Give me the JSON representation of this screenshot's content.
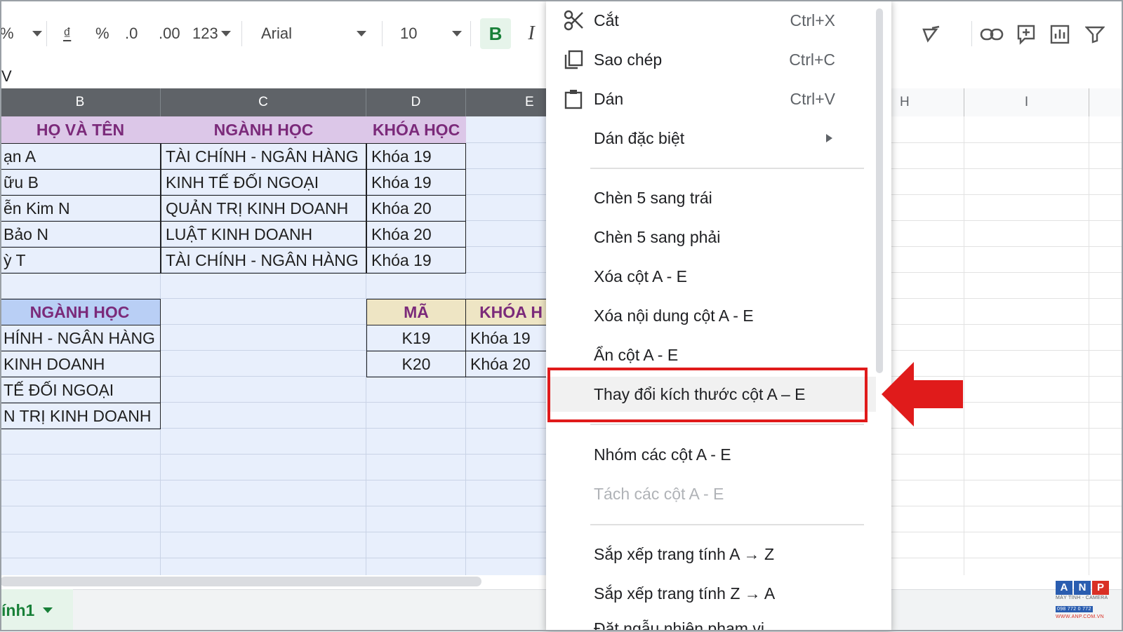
{
  "toolbar": {
    "percent": "%",
    "currency": "₫",
    "percent_format": "%",
    "decrease_decimal": ".0",
    "increase_decimal": ".00",
    "more_formats": "123",
    "font_name": "Arial",
    "font_size": "10",
    "bold": "B",
    "italic": "I"
  },
  "formula_bar": {
    "value": "V"
  },
  "columns_left": [
    "B",
    "C",
    "D",
    "E"
  ],
  "columns_right": [
    "H",
    "I"
  ],
  "table1": {
    "headers": [
      "HỌ VÀ TÊN",
      "NGÀNH HỌC",
      "KHÓA HỌC"
    ],
    "rows": [
      [
        "ạn A",
        "TÀI CHÍNH - NGÂN HÀNG",
        "Khóa 19"
      ],
      [
        "ữu B",
        "KINH TẾ ĐỐI NGOẠI",
        "Khóa 19"
      ],
      [
        "ễn Kim N",
        "QUẢN TRỊ KINH DOANH",
        "Khóa 20"
      ],
      [
        "Bảo N",
        "LUẬT KINH DOANH",
        "Khóa 20"
      ],
      [
        "ỳ T",
        "TÀI CHÍNH - NGÂN HÀNG",
        "Khóa 19"
      ]
    ]
  },
  "table2": {
    "header": "NGÀNH HỌC",
    "rows": [
      "HÍNH - NGÂN HÀNG",
      "KINH DOANH",
      "TẾ ĐỐI NGOẠI",
      "N TRỊ KINH DOANH"
    ]
  },
  "table3": {
    "headers": [
      "MÃ",
      "KHÓA H"
    ],
    "rows": [
      [
        "K19",
        "Khóa 19"
      ],
      [
        "K20",
        "Khóa 20"
      ]
    ]
  },
  "sheet_tab": {
    "label": "ính1"
  },
  "context_menu": {
    "cut": {
      "label": "Cắt",
      "shortcut": "Ctrl+X"
    },
    "copy": {
      "label": "Sao chép",
      "shortcut": "Ctrl+C"
    },
    "paste": {
      "label": "Dán",
      "shortcut": "Ctrl+V"
    },
    "paste_special": "Dán đặc biệt",
    "insert_left": "Chèn 5 sang trái",
    "insert_right": "Chèn 5 sang phải",
    "delete_columns": "Xóa cột A - E",
    "clear_columns": "Xóa nội dung cột A - E",
    "hide_columns": "Ẩn cột A - E",
    "resize_columns": "Thay đổi kích thước cột A – E",
    "group_columns": "Nhóm các cột A - E",
    "ungroup_columns": "Tách các cột A - E",
    "sort_az": "Sắp xếp trang tính A → Z",
    "sort_za": "Sắp xếp trang tính Z → A",
    "randomize": "Đặt ngẫu nhiên phạm vi"
  },
  "colors": {
    "highlight_border": "#e01b1b",
    "arrow": "#e01b1b",
    "header_purple": "#dcc7e8",
    "header_blue": "#b9cff5",
    "header_tan": "#eee5c4",
    "selection_bg": "#e8effc"
  },
  "logo": {
    "letters": [
      "A",
      "N",
      "P"
    ],
    "line1": "MÁY TÍNH - CAMERA",
    "line2": "098 772 0 772",
    "line3": "WWW.ANP.COM.VN"
  },
  "icons": [
    "scissors-icon",
    "copy-icon",
    "clipboard-icon",
    "link-icon",
    "add-comment-icon",
    "chart-icon",
    "filter-icon",
    "paint-format-icon"
  ]
}
